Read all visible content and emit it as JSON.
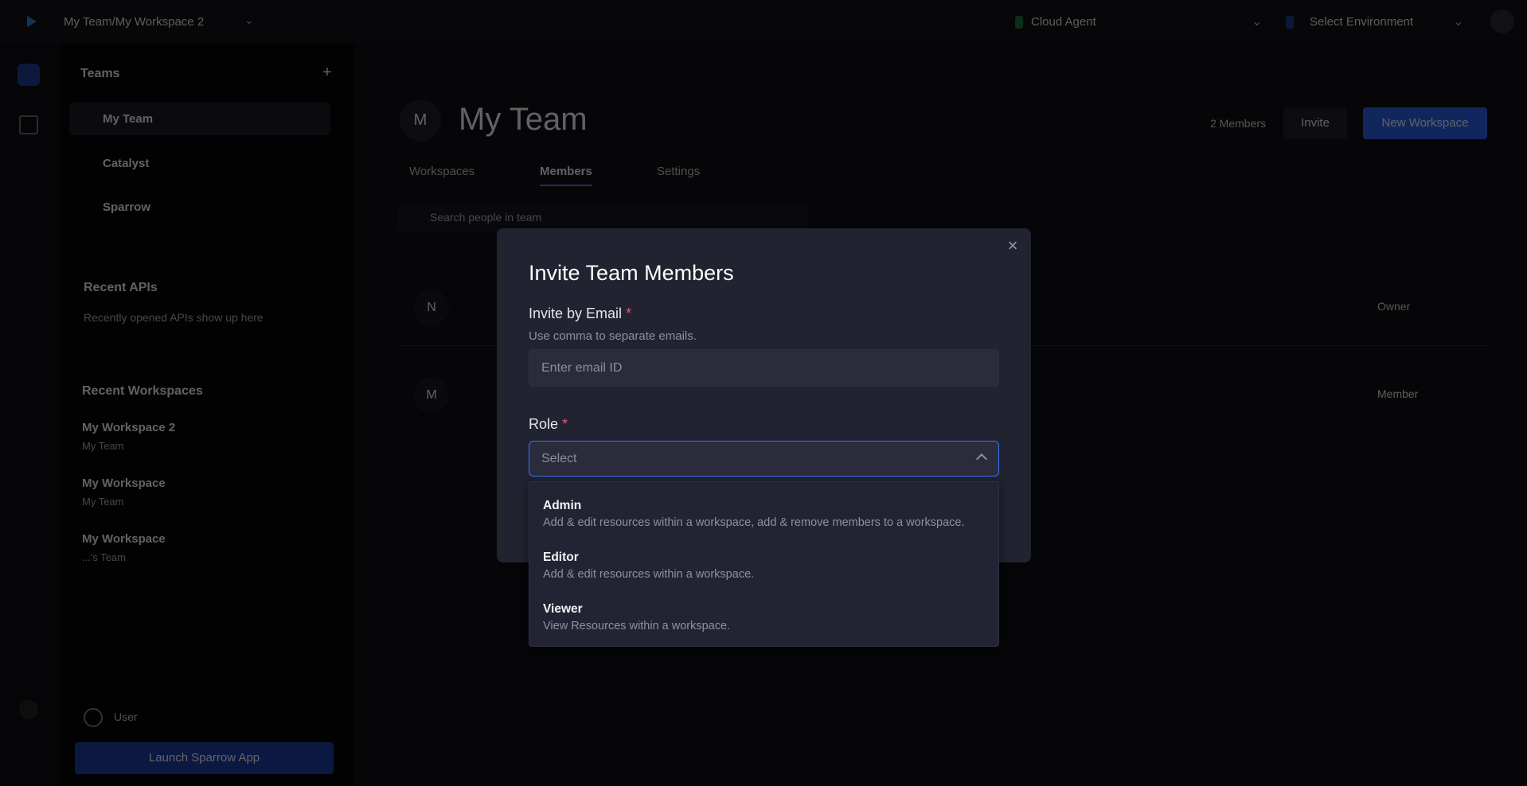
{
  "topbar": {
    "breadcrumb": "My Team/My Workspace 2",
    "agent": "Cloud Agent",
    "environment": "Select Environment"
  },
  "sidebar": {
    "teams_heading": "Teams",
    "teams": [
      {
        "label": "My Team"
      },
      {
        "label": "Catalyst"
      },
      {
        "label": "Sparrow"
      }
    ],
    "recent_apis_heading": "Recent APIs",
    "recent_apis_empty": "Recently opened APIs show up here",
    "recent_workspaces_heading": "Recent Workspaces",
    "recent_workspaces": [
      {
        "name": "My Workspace 2",
        "team": "My Team"
      },
      {
        "name": "My Workspace",
        "team": "My Team"
      },
      {
        "name": "My Workspace",
        "team": "...'s Team"
      }
    ],
    "user": "User",
    "launch_button": "Launch Sparrow App"
  },
  "main": {
    "team_title": "My Team",
    "avatar_initials": "M",
    "tabs": [
      {
        "label": "Workspaces"
      },
      {
        "label": "Members"
      },
      {
        "label": "Settings"
      }
    ],
    "members_count": "2 Members",
    "invite_button": "Invite",
    "new_workspace_button": "New Workspace",
    "search_placeholder": "Search people in team",
    "members": [
      {
        "initials": "N",
        "role": "Owner"
      },
      {
        "initials": "M",
        "role": "Member"
      }
    ]
  },
  "modal": {
    "title": "Invite Team Members",
    "email_label": "Invite by Email",
    "required_mark": "*",
    "email_hint": "Use comma to separate emails.",
    "email_placeholder": "Enter email ID",
    "role_label": "Role",
    "role_placeholder": "Select",
    "role_options": [
      {
        "title": "Admin",
        "description": "Add & edit resources within a workspace, add & remove members to a workspace."
      },
      {
        "title": "Editor",
        "description": "Add & edit resources within a workspace."
      },
      {
        "title": "Viewer",
        "description": "View Resources within a workspace."
      }
    ],
    "close_icon": "×"
  },
  "colors": {
    "accent": "#3670f7",
    "modal_bg": "#222330",
    "required": "#e05a6a"
  }
}
